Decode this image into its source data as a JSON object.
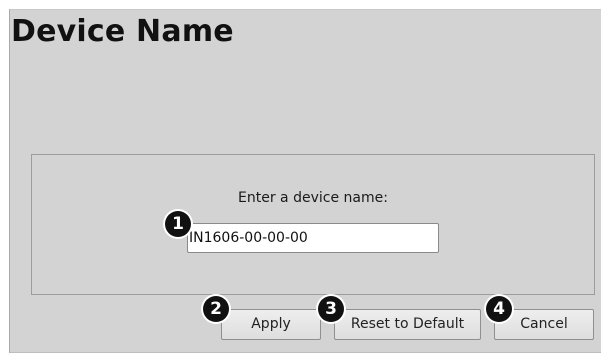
{
  "page": {
    "title": "Device Name"
  },
  "form": {
    "prompt": "Enter a device name:",
    "device_name_value": "IN1606-00-00-00"
  },
  "buttons": {
    "apply": "Apply",
    "reset": "Reset to Default",
    "cancel": "Cancel"
  },
  "callouts": [
    "1",
    "2",
    "3",
    "4"
  ]
}
